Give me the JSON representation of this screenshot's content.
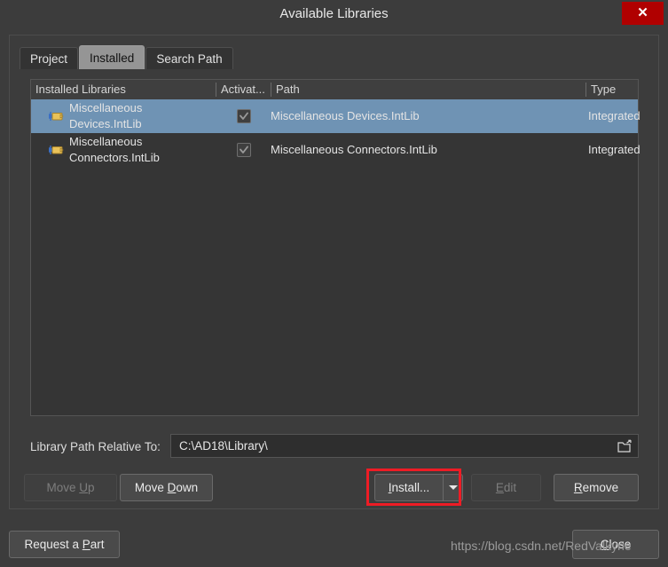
{
  "window": {
    "title": "Available Libraries",
    "close_glyph": "✕"
  },
  "tabs": [
    {
      "label": "Project",
      "active": false
    },
    {
      "label": "Installed",
      "active": true
    },
    {
      "label": "Search Path",
      "active": false
    }
  ],
  "table": {
    "columns": [
      {
        "label": "Installed Libraries"
      },
      {
        "label": "Activat..."
      },
      {
        "label": "Path"
      },
      {
        "label": "Type"
      }
    ],
    "rows": [
      {
        "name": "Miscellaneous Devices.IntLib",
        "activated": true,
        "path": "Miscellaneous Devices.IntLib",
        "type": "Integrated",
        "selected": true
      },
      {
        "name": "Miscellaneous Connectors.IntLib",
        "activated": true,
        "path": "Miscellaneous Connectors.IntLib",
        "type": "Integrated",
        "selected": false
      }
    ]
  },
  "path_row": {
    "label": "Library Path Relative To:",
    "value": "C:\\AD18\\Library\\",
    "placeholder": "",
    "browse_icon": "folder-browse-icon"
  },
  "buttons": {
    "move_up": {
      "label": "Move Up",
      "accel": "U",
      "enabled": false
    },
    "move_down": {
      "label": "Move Down",
      "accel": "D",
      "enabled": true
    },
    "install": {
      "label": "Install...",
      "accel": "I",
      "enabled": true
    },
    "install_dropdown": {
      "label": "",
      "enabled": true
    },
    "edit": {
      "label": "Edit",
      "accel": "E",
      "enabled": false
    },
    "remove": {
      "label": "Remove",
      "accel": "R",
      "enabled": true
    },
    "request_part": {
      "label": "Request a Part",
      "accel": "P",
      "enabled": true
    },
    "close": {
      "label": "Close",
      "accel": "C",
      "enabled": true
    }
  },
  "annotations": {
    "install_highlight_color": "#ee1c25"
  },
  "watermark": {
    "text": "https://blog.csdn.net/RedValkyrie"
  },
  "colors": {
    "window_bg": "#3c3c3c",
    "list_bg": "#353535",
    "selection": "#6f93b4",
    "close_red": "#b00000",
    "annotation_red": "#ee1c25"
  }
}
